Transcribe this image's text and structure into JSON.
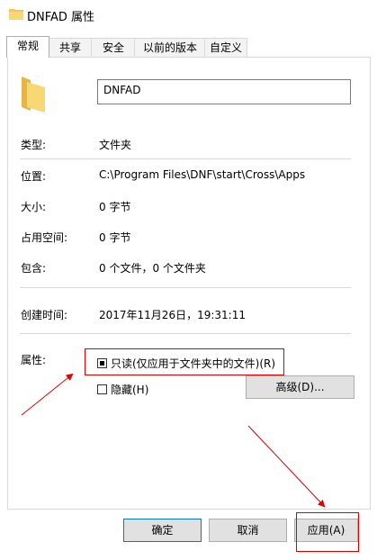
{
  "window": {
    "title": "DNFAD 属性"
  },
  "tabs": [
    {
      "label": "常规",
      "active": true
    },
    {
      "label": "共享",
      "active": false
    },
    {
      "label": "安全",
      "active": false
    },
    {
      "label": "以前的版本",
      "active": false
    },
    {
      "label": "自定义",
      "active": false
    }
  ],
  "folder": {
    "name": "DNFAD"
  },
  "info": {
    "type_label": "类型:",
    "type_value": "文件夹",
    "location_label": "位置:",
    "location_value": "C:\\Program Files\\DNF\\start\\Cross\\Apps",
    "size_label": "大小:",
    "size_value": "0 字节",
    "disk_label": "占用空间:",
    "disk_value": "0 字节",
    "contains_label": "包含:",
    "contains_value": "0 个文件，0 个文件夹",
    "created_label": "创建时间:",
    "created_value": "2017年11月26日，19:31:11"
  },
  "attributes": {
    "label": "属性:",
    "readonly": {
      "label": "只读(仅应用于文件夹中的文件)(R)",
      "state": "indeterminate"
    },
    "hidden": {
      "label": "隐藏(H)",
      "checked": false
    },
    "advanced_label": "高级(D)..."
  },
  "buttons": {
    "ok": "确定",
    "cancel": "取消",
    "apply": "应用(A)"
  },
  "colors": {
    "annotation": "#e00000",
    "folder": "#f3c65a",
    "accent": "#0078d7"
  }
}
